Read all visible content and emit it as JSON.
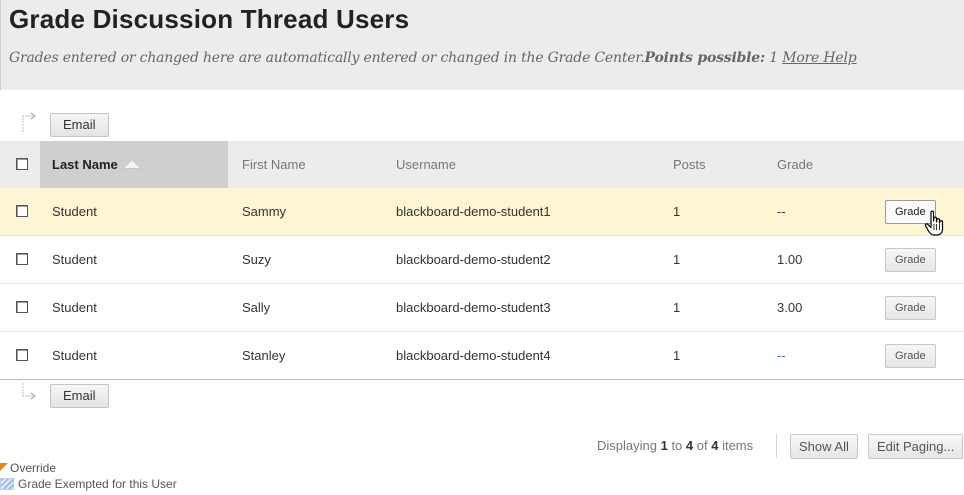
{
  "header": {
    "title": "Grade Discussion Thread Users",
    "subtitle": "Grades entered or changed here are automatically entered or changed in the Grade Center.",
    "points_label": "Points possible:",
    "points_value": "1",
    "help_link": "More Help"
  },
  "toolbar": {
    "email_label": "Email"
  },
  "table": {
    "columns": [
      "Last Name",
      "First Name",
      "Username",
      "Posts",
      "Grade"
    ],
    "sorted_column": "Last Name",
    "sort_direction": "ascending",
    "rows": [
      {
        "last": "Student",
        "first": "Sammy",
        "username": "blackboard-demo-student1",
        "posts": "1",
        "grade": "--",
        "button": "Grade"
      },
      {
        "last": "Student",
        "first": "Suzy",
        "username": "blackboard-demo-student2",
        "posts": "1",
        "grade": "1.00",
        "button": "Grade"
      },
      {
        "last": "Student",
        "first": "Sally",
        "username": "blackboard-demo-student3",
        "posts": "1",
        "grade": "3.00",
        "button": "Grade"
      },
      {
        "last": "Student",
        "first": "Stanley",
        "username": "blackboard-demo-student4",
        "posts": "1",
        "grade": "--",
        "button": "Grade"
      }
    ]
  },
  "footer": {
    "display_prefix": "Displaying ",
    "display_from": "1",
    "display_to_word": " to ",
    "display_to": "4",
    "display_of_word": " of ",
    "display_total": "4",
    "display_suffix": " items",
    "show_all": "Show All",
    "edit_paging": "Edit Paging..."
  },
  "legend": {
    "override": "Override",
    "exempt": "Grade Exempted for this User"
  },
  "colors": {
    "highlight_row": "#fdf5d3",
    "override_marker": "#e08a1e",
    "exempt_marker": "#9bbde8"
  }
}
